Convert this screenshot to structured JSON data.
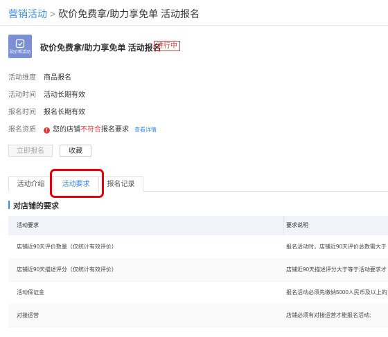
{
  "breadcrumb": {
    "parent": "营销活动",
    "separator": ">",
    "current": "砍价免费拿/助力享免单 活动报名"
  },
  "activity": {
    "logo_text": "砍价帮活动",
    "title": "砍价免费拿/助力享免单 活动报名",
    "status_badge": "进行中"
  },
  "info": [
    {
      "key": "活动维度",
      "value": "商品报名"
    },
    {
      "key": "活动时间",
      "value": "活动长期有效"
    },
    {
      "key": "报名时间",
      "value": "报名长期有效"
    }
  ],
  "qualification": {
    "key": "报名资质",
    "text_before": "您的店铺",
    "text_red": "不符合",
    "text_after": "报名要求",
    "detail_link": "查看详情"
  },
  "buttons": {
    "signup": "立即报名",
    "favorite": "收藏"
  },
  "tabs": [
    {
      "label": "活动介绍",
      "active": false
    },
    {
      "label": "活动要求",
      "active": true
    },
    {
      "label": "报名记录",
      "active": false
    }
  ],
  "section_title": "对店铺的要求",
  "table": {
    "headers": [
      "活动要求",
      "要求说明"
    ],
    "rows": [
      [
        "店铺近90天评价数量（仅统计有效评价）",
        "报名活动时，店铺近90天评价总数需大于"
      ],
      [
        "店铺近90天描述评分（仅统计有效评价）",
        "店铺近90天描述评分大于等于活动要求才"
      ],
      [
        "活动保证金",
        "报名活动必须先缴纳5000人民币及以上的"
      ],
      [
        "对接运营",
        "店铺必须有对接运营才能报名活动;"
      ]
    ]
  },
  "colors": {
    "accent": "#3a8ee6",
    "danger": "#e4393c",
    "highlight": "#e8000b"
  }
}
